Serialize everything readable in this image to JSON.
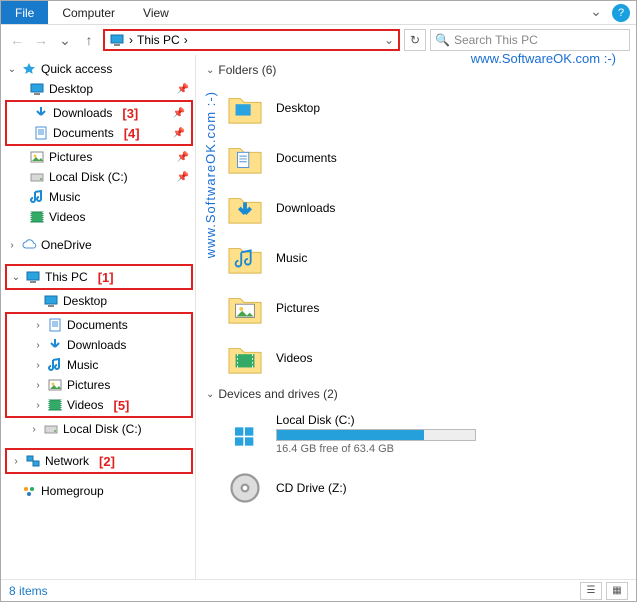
{
  "ribbon": {
    "file": "File",
    "computer": "Computer",
    "view": "View"
  },
  "addr": {
    "location": "This PC",
    "sep": "›"
  },
  "search": {
    "placeholder": "Search This PC"
  },
  "watermark": "www.SoftwareOK.com  :-)",
  "watermark_v": "www.SoftwareOK.com  :-)",
  "sidebar": {
    "quick_access": "Quick access",
    "qa_items": [
      {
        "label": "Desktop",
        "ico": "desktop"
      },
      {
        "label": "Downloads",
        "ico": "downloads",
        "annot": "[3]"
      },
      {
        "label": "Documents",
        "ico": "documents",
        "annot": "[4]"
      },
      {
        "label": "Pictures",
        "ico": "pictures"
      },
      {
        "label": "Local Disk (C:)",
        "ico": "drive"
      },
      {
        "label": "Music",
        "ico": "music"
      },
      {
        "label": "Videos",
        "ico": "videos"
      }
    ],
    "onedrive": "OneDrive",
    "this_pc": "This PC",
    "this_pc_annot": "[1]",
    "pc_items_top": [
      {
        "label": "Desktop",
        "ico": "desktop"
      }
    ],
    "pc_items_box": [
      {
        "label": "Documents",
        "ico": "documents"
      },
      {
        "label": "Downloads",
        "ico": "downloads"
      },
      {
        "label": "Music",
        "ico": "music"
      },
      {
        "label": "Pictures",
        "ico": "pictures"
      },
      {
        "label": "Videos",
        "ico": "videos",
        "annot": "[5]"
      }
    ],
    "pc_items_after": [
      {
        "label": "Local Disk (C:)",
        "ico": "drive"
      }
    ],
    "network": "Network",
    "network_annot": "[2]",
    "homegroup": "Homegroup"
  },
  "content": {
    "folders_head": "Folders (6)",
    "folders": [
      {
        "label": "Desktop",
        "ico": "desktop"
      },
      {
        "label": "Documents",
        "ico": "documents"
      },
      {
        "label": "Downloads",
        "ico": "downloads"
      },
      {
        "label": "Music",
        "ico": "music"
      },
      {
        "label": "Pictures",
        "ico": "pictures"
      },
      {
        "label": "Videos",
        "ico": "videos"
      }
    ],
    "drives_head": "Devices and drives (2)",
    "local_disk": {
      "label": "Local Disk (C:)",
      "free_text": "16.4 GB free of 63.4 GB",
      "fill_pct": 74
    },
    "cd_drive": {
      "label": "CD Drive (Z:)"
    }
  },
  "status": {
    "items": "8 items"
  }
}
